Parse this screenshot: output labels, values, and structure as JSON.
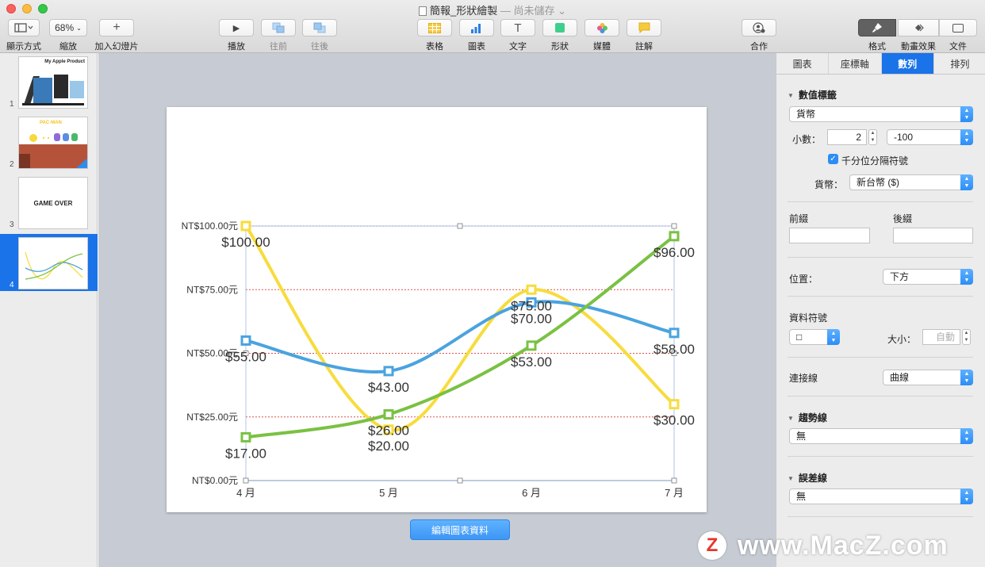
{
  "window": {
    "title": "簡報_形狀繪製",
    "status": "— 尚未儲存 ⌄"
  },
  "toolbar": {
    "view_label": "顯示方式",
    "zoom_value": "68%",
    "zoom_label": "縮放",
    "add_slide_label": "加入幻燈片",
    "play_label": "播放",
    "forward_label": "往前",
    "backward_label": "往後",
    "table_label": "表格",
    "chart_label": "圖表",
    "text_label": "文字",
    "shape_label": "形狀",
    "media_label": "媒體",
    "comment_label": "註解",
    "collaborate_label": "合作",
    "format_label": "格式",
    "animate_label": "動畫效果",
    "document_label": "文件",
    "icons": [
      "sidebar-icon",
      "plus-icon",
      "play-icon",
      "bring-forward-icon",
      "send-backward-icon",
      "table-icon",
      "chart-icon",
      "text-icon",
      "shape-icon",
      "media-icon",
      "comment-icon",
      "collaborate-icon",
      "format-brush-icon",
      "animate-diamond-icon",
      "document-icon"
    ]
  },
  "slides": [
    {
      "number": "1",
      "title": "My Apple Product"
    },
    {
      "number": "2",
      "title": "PAC-MAN"
    },
    {
      "number": "3",
      "title": "GAME OVER"
    },
    {
      "number": "4",
      "title": ""
    }
  ],
  "chart_data": {
    "type": "line",
    "categories": [
      "4 月",
      "5 月",
      "6 月",
      "7 月"
    ],
    "series": [
      {
        "color": "#f7dc3d",
        "values": [
          100,
          20,
          75,
          30
        ],
        "labels": [
          "$100.00",
          "$20.00",
          "$75.00",
          "$30.00"
        ]
      },
      {
        "color": "#4aa3df",
        "values": [
          55,
          43,
          70,
          58
        ],
        "labels": [
          "$55.00",
          "$43.00",
          "$70.00",
          "$58.00"
        ]
      },
      {
        "color": "#7ac143",
        "values": [
          17,
          26,
          53,
          96
        ],
        "labels": [
          "$17.00",
          "$26.00",
          "$53.00",
          "$96.00"
        ]
      }
    ],
    "yticks": [
      0,
      25,
      50,
      75,
      100
    ],
    "ytick_labels": [
      "NT$0.00元",
      "NT$25.00元",
      "NT$50.00元",
      "NT$75.00元",
      "NT$100.00元"
    ],
    "ylim": [
      0,
      100
    ],
    "grid": true,
    "gridline_color": "#d9534f",
    "top_gridline_color": "#8e44ad",
    "smooth": true,
    "title": "",
    "xlabel": "",
    "ylabel": ""
  },
  "edit_chart_button": "編輯圖表資料",
  "inspector": {
    "tabs": [
      "圖表",
      "座標軸",
      "數列",
      "排列"
    ],
    "active_tab": "數列",
    "value_labels": {
      "title": "數值標籤",
      "format": "貨幣",
      "decimals_label": "小數：",
      "decimals_value": "2",
      "negative_format": "-100",
      "thousands_separator": "千分位分隔符號",
      "currency_label": "貨幣：",
      "currency_value": "新台幣 ($)",
      "prefix_label": "前綴",
      "suffix_label": "後綴",
      "prefix_value": "",
      "suffix_value": "",
      "position_label": "位置：",
      "position_value": "下方"
    },
    "data_symbol": {
      "title": "資料符號",
      "symbol_value": "□",
      "size_label": "大小：",
      "size_placeholder": "自動"
    },
    "connection_line": {
      "label": "連接線",
      "value": "曲線"
    },
    "trendline": {
      "title": "趨勢線",
      "value": "無"
    },
    "error_bars": {
      "title": "誤差線",
      "value": "無"
    }
  },
  "watermark": {
    "logo": "Z",
    "text": "www.MacZ.com"
  }
}
